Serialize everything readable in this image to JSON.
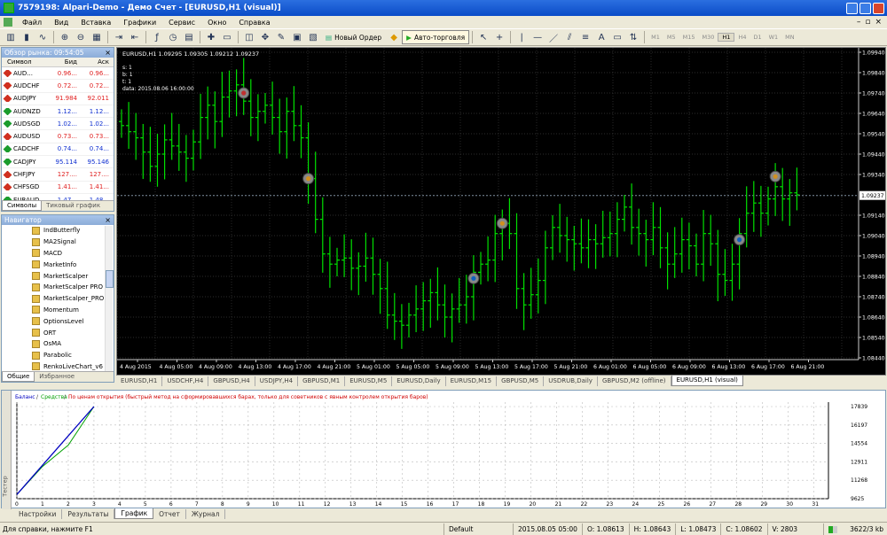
{
  "window": {
    "title": "7579198: Alpari-Demo - Демо Счет - [EURUSD,H1 (visual)]"
  },
  "menu": [
    "Файл",
    "Вид",
    "Вставка",
    "Графики",
    "Сервис",
    "Окно",
    "Справка"
  ],
  "toolbar": {
    "new_order": "Новый Ордер",
    "autotrading": "Авто-торговля",
    "timeframes": [
      "M1",
      "M5",
      "M15",
      "M30",
      "H1",
      "H4",
      "D1",
      "W1",
      "MN"
    ],
    "active_tf": "H1",
    "text_tool": "A"
  },
  "market_watch": {
    "title": "Обзор рынка: 09:54:05",
    "col_symbol": "Символ",
    "col_bid": "Бид",
    "col_ask": "Аск",
    "rows": [
      {
        "s": "AUD...",
        "b": "0.96...",
        "a": "0.96...",
        "dir": "dn"
      },
      {
        "s": "AUDCHF",
        "b": "0.72...",
        "a": "0.72...",
        "dir": "dn"
      },
      {
        "s": "AUDJPY",
        "b": "91.984",
        "a": "92.011",
        "dir": "dn"
      },
      {
        "s": "AUDNZD",
        "b": "1.12...",
        "a": "1.12...",
        "dir": "up"
      },
      {
        "s": "AUDSGD",
        "b": "1.02...",
        "a": "1.02...",
        "dir": "up"
      },
      {
        "s": "AUDUSD",
        "b": "0.73...",
        "a": "0.73...",
        "dir": "dn"
      },
      {
        "s": "CADCHF",
        "b": "0.74...",
        "a": "0.74...",
        "dir": "up"
      },
      {
        "s": "CADJPY",
        "b": "95.114",
        "a": "95.146",
        "dir": "up"
      },
      {
        "s": "CHFJPY",
        "b": "127....",
        "a": "127....",
        "dir": "dn"
      },
      {
        "s": "CHFSGD",
        "b": "1.41...",
        "a": "1.41...",
        "dir": "dn"
      },
      {
        "s": "EURAUD",
        "b": "1.47...",
        "a": "1.48...",
        "dir": "up"
      }
    ],
    "tabs": [
      "Символы",
      "Тиковый график"
    ]
  },
  "navigator": {
    "title": "Навигатор",
    "items": [
      "IndButterfly",
      "MA2Signal",
      "MACD",
      "MarketInfo",
      "MarketScalper",
      "MarketScalper PRO",
      "MarketScalper_PRO",
      "Momentum",
      "OptionsLevel",
      "ORT",
      "OsMA",
      "Parabolic",
      "RenkoLiveChart_v6"
    ],
    "tabs": [
      "Общие",
      "Избранное"
    ]
  },
  "chart": {
    "header": "EURUSD,H1  1.09295 1.09305 1.09212 1.09237",
    "info": [
      "s: 1",
      "b: 1",
      "t: 1",
      "data: 2015.08.06 16:00:00"
    ],
    "price_labels": [
      "1.09940",
      "1.09840",
      "1.09740",
      "1.09640",
      "1.09540",
      "1.09440",
      "1.09340",
      "1.09237",
      "1.09140",
      "1.09040",
      "1.08940",
      "1.08840",
      "1.08740",
      "1.08640",
      "1.08540",
      "1.08440"
    ],
    "current_price": "1.09237",
    "time_labels": [
      "4 Aug 2015",
      "4 Aug 05:00",
      "4 Aug 09:00",
      "4 Aug 13:00",
      "4 Aug 17:00",
      "4 Aug 21:00",
      "5 Aug 01:00",
      "5 Aug 05:00",
      "5 Aug 09:00",
      "5 Aug 13:00",
      "5 Aug 17:00",
      "5 Aug 21:00",
      "6 Aug 01:00",
      "6 Aug 05:00",
      "6 Aug 09:00",
      "6 Aug 13:00",
      "6 Aug 17:00",
      "6 Aug 21:00"
    ],
    "colors": {
      "bg": "#000000",
      "bar": "#00e000",
      "grid": "#3a3a3a",
      "text": "#ffffff",
      "price_line": "#8090a0"
    }
  },
  "chart_data": {
    "type": "ohlc",
    "symbol": "EURUSD",
    "timeframe": "H1",
    "ylim": [
      1.0844,
      1.0994
    ],
    "closes": [
      1.0958,
      1.0955,
      1.0952,
      1.0945,
      1.0938,
      1.0944,
      1.0951,
      1.0948,
      1.0945,
      1.0942,
      1.095,
      1.0962,
      1.0968,
      1.096,
      1.0972,
      1.0975,
      1.0978,
      1.097,
      1.0962,
      1.0965,
      1.0968,
      1.0962,
      1.0955,
      1.0965,
      1.0958,
      1.0952,
      1.0932,
      1.0912,
      1.0895,
      1.089,
      1.0892,
      1.0893,
      1.0888,
      1.0889,
      1.0893,
      1.0885,
      1.0878,
      1.0865,
      1.0862,
      1.086,
      1.0865,
      1.0868,
      1.0872,
      1.0876,
      1.087,
      1.0864,
      1.0868,
      1.087,
      1.0874,
      1.0886,
      1.089,
      1.0892,
      1.0905,
      1.091,
      1.0905,
      1.0878,
      1.087,
      1.0875,
      1.0882,
      1.0898,
      1.0908,
      1.0904,
      1.0902,
      1.09,
      1.0898,
      1.0902,
      1.09,
      1.0903,
      1.0905,
      1.0912,
      1.0918,
      1.0908,
      1.0905,
      1.0902,
      1.0908,
      1.0898,
      1.089,
      1.0895,
      1.0902,
      1.0899,
      1.089,
      1.0905,
      1.09,
      1.0885,
      1.0882,
      1.089,
      1.0905,
      1.0915,
      1.092,
      1.0915,
      1.0922,
      1.0928,
      1.0922,
      1.0925,
      1.0924
    ]
  },
  "chart_tabs": [
    "EURUSD,H1",
    "USDCHF,H4",
    "GBPUSD,H4",
    "USDJPY,H4",
    "GBPUSD,M1",
    "EURUSD,M5",
    "EURUSD,Daily",
    "EURUSD,M15",
    "GBPUSD,M5",
    "USDRUB,Daily",
    "GBPUSD,M2 (offline)",
    "EURUSD,H1 (visual)"
  ],
  "tester": {
    "legend_balance": "Баланс",
    "legend_equity": "Средства",
    "legend_note": "По ценам открытия (быстрый метод на сформировавшихся барах, только для советников с явным контролем открытия баров)",
    "y_labels": [
      "17839",
      "16197",
      "14554",
      "12911",
      "11268",
      "9625"
    ],
    "x_labels": [
      "0",
      "1",
      "2",
      "3",
      "4",
      "5",
      "6",
      "7",
      "8",
      "9",
      "10",
      "11",
      "12",
      "13",
      "14",
      "15",
      "16",
      "17",
      "18",
      "19",
      "20",
      "21",
      "22",
      "23",
      "24",
      "25",
      "26",
      "27",
      "28",
      "29",
      "30",
      "31"
    ],
    "side": "Тестер",
    "tabs": [
      "Настройки",
      "Результаты",
      "График",
      "Отчет",
      "Журнал"
    ],
    "colors": {
      "balance": "#0000c0",
      "equity": "#00a000"
    }
  },
  "status": {
    "help": "Для справки, нажмите F1",
    "profile": "Default",
    "time": "2015.08.05 05:00",
    "o": "O: 1.08613",
    "h": "H: 1.08643",
    "l": "L: 1.08473",
    "c": "C: 1.08602",
    "v": "V: 2803",
    "traffic": "3622/3 kb"
  }
}
